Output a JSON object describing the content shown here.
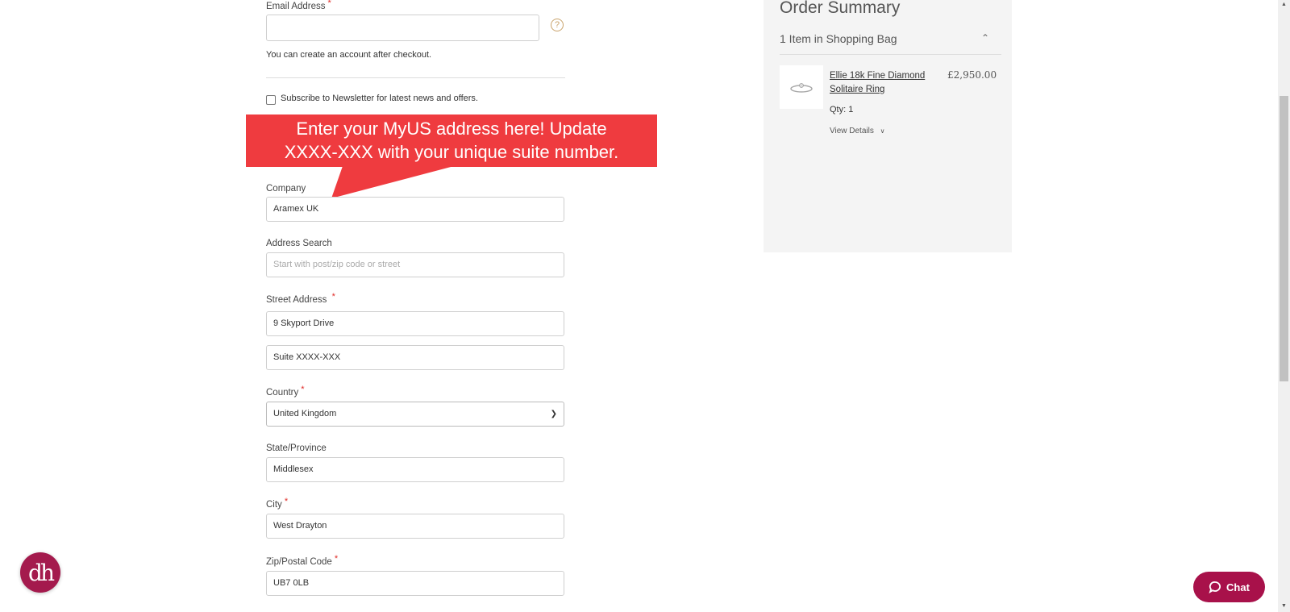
{
  "form": {
    "email": {
      "label": "Email Address",
      "value": "",
      "help_icon": "question-circle-icon"
    },
    "account_note": "You can create an account after checkout.",
    "newsletter_label": "Subscribe to Newsletter for latest news and offers.",
    "company": {
      "label": "Company",
      "value": "Aramex UK"
    },
    "address_search": {
      "label": "Address Search",
      "placeholder": "Start with post/zip code or street"
    },
    "street": {
      "label": "Street Address",
      "line1": "9 Skyport Drive",
      "line2": "Suite XXXX-XXX"
    },
    "country": {
      "label": "Country",
      "value": "United Kingdom"
    },
    "state": {
      "label": "State/Province",
      "value": "Middlesex"
    },
    "city": {
      "label": "City",
      "value": "West Drayton"
    },
    "zip": {
      "label": "Zip/Postal Code",
      "value": "UB7 0LB"
    },
    "required_mark": "*"
  },
  "callout": {
    "line1": "Enter your MyUS address here! Update",
    "line2": "XXXX-XXX with your unique suite number.",
    "color": "#ef3b3f"
  },
  "summary": {
    "title": "Order Summary",
    "items_header": "1 Item in Shopping Bag",
    "item": {
      "name_line1": "Ellie 18k Fine Diamond",
      "name_line2": "Solitaire Ring",
      "price": "£2,950.00",
      "qty": "Qty: 1",
      "view_details": "View Details"
    }
  },
  "chat": {
    "label": "Chat",
    "color": "#a8114a"
  },
  "logo": {
    "text": "dh",
    "color": "#a41a4d"
  }
}
